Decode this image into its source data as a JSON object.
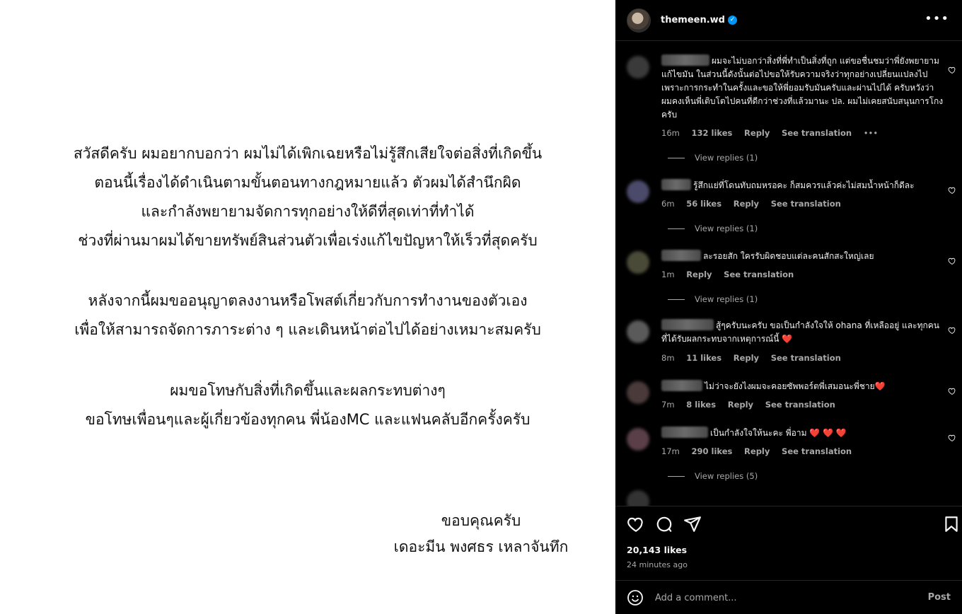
{
  "post_image": {
    "paragraph_1": [
      "สวัสดีครับ ผมอยากบอกว่า ผมไม่ได้เพิกเฉยหรือไม่รู้สึกเสียใจต่อสิ่งที่เกิดขึ้น",
      "ตอนนี้เรื่องได้ดำเนินตามขั้นตอนทางกฎหมายแล้ว ตัวผมได้สำนึกผิด",
      "และกำลังพยายามจัดการทุกอย่างให้ดีที่สุดเท่าที่ทำได้",
      "ช่วงที่ผ่านมาผมได้ขายทรัพย์สินส่วนตัวเพื่อเร่งแก้ไขปัญหาให้เร็วที่สุดครับ"
    ],
    "paragraph_2": [
      "หลังจากนี้ผมขออนุญาตลงงานหรือโพสต์เกี่ยวกับการทำงานของตัวเอง",
      "เพื่อให้สามารถจัดการภาระต่าง ๆ และเดินหน้าต่อไปได้อย่างเหมาะสมครับ"
    ],
    "paragraph_3": [
      "ผมขอโทษกับสิ่งที่เกิดขึ้นและผลกระทบต่างๆ",
      "ขอโทษเพื่อนๆและผู้เกี่ยวข้องทุกคน พี่น้องMC และแฟนคลับอีกครั้งครับ"
    ],
    "signoff": [
      "ขอบคุณครับ",
      "เดอะมีน พงศธร เหลาจันทึก"
    ]
  },
  "header": {
    "username": "themeen.wd",
    "verified_mark": "✓",
    "more": "•••"
  },
  "comments": [
    {
      "text": "ผมจะไม่บอกว่าสิ่งที่พี่ทำเป็นสิ่งที่ถูก แต่ขอชื่นชมว่าพี่ยังพยายามแก้ไขมัน ในส่วนนี้ดังนั้นต่อไปขอให้รับความจริงว่าทุกอย่างเปลี่ยนแปลงไปเพราะการกระทำในครั้งและขอให้พี่ยอมรับมันครับและผ่านไปได้ ครับหวังว่าผมคงเห็นพี่เติบโตไปคนที่ดีกว่าช่วงที่แล้วมานะ ปล. ผมไม่เคยสนับสนุนการโกง ครับ",
      "time": "16m",
      "likes": "132 likes",
      "reply": "Reply",
      "translate": "See translation",
      "more": "•••",
      "view_replies": "View replies (1)"
    },
    {
      "text": "รู้สึกแย่ที่โดนทับถมหรอคะ ก็สมควรแล้วค่ะไม่สมน้ำหน้าก็ดีละ",
      "time": "6m",
      "likes": "56 likes",
      "reply": "Reply",
      "translate": "See translation",
      "view_replies": "View replies (1)"
    },
    {
      "text": "ละรอยสัก ใครรับผิดชอบแต่ละคนสักสะใหญ่เลย",
      "time": "1m",
      "reply": "Reply",
      "translate": "See translation",
      "view_replies": "View replies (1)"
    },
    {
      "text": "สู้ๆครับนะครับ ขอเป็นกำลังใจให้ ohana ที่เหลืออยู่ และทุกคนที่ได้รับผลกระทบจากเหตุการณ์นี้",
      "hearts": "❤️",
      "time": "8m",
      "likes": "11 likes",
      "reply": "Reply",
      "translate": "See translation"
    },
    {
      "text": "ไม่ว่าจะยังไงผมจะคอยซัพพอร์ตพี่เสมอนะพี่ชาย",
      "hearts": "❤️",
      "time": "7m",
      "likes": "8 likes",
      "reply": "Reply",
      "translate": "See translation"
    },
    {
      "text": "เป็นกำลังใจให้นะคะ พี่อาม",
      "hearts": "❤️ ❤️ ❤️",
      "time": "17m",
      "likes": "290 likes",
      "reply": "Reply",
      "translate": "See translation",
      "view_replies": "View replies (5)"
    }
  ],
  "actions": {
    "likes": "20,143 likes",
    "time_ago": "24 minutes ago"
  },
  "add_comment": {
    "placeholder": "Add a comment...",
    "post": "Post"
  },
  "colors": {
    "panel_bg": "#000000",
    "accent": "#0095f6",
    "heart": "#ed4956",
    "muted": "#a8a8a8"
  }
}
